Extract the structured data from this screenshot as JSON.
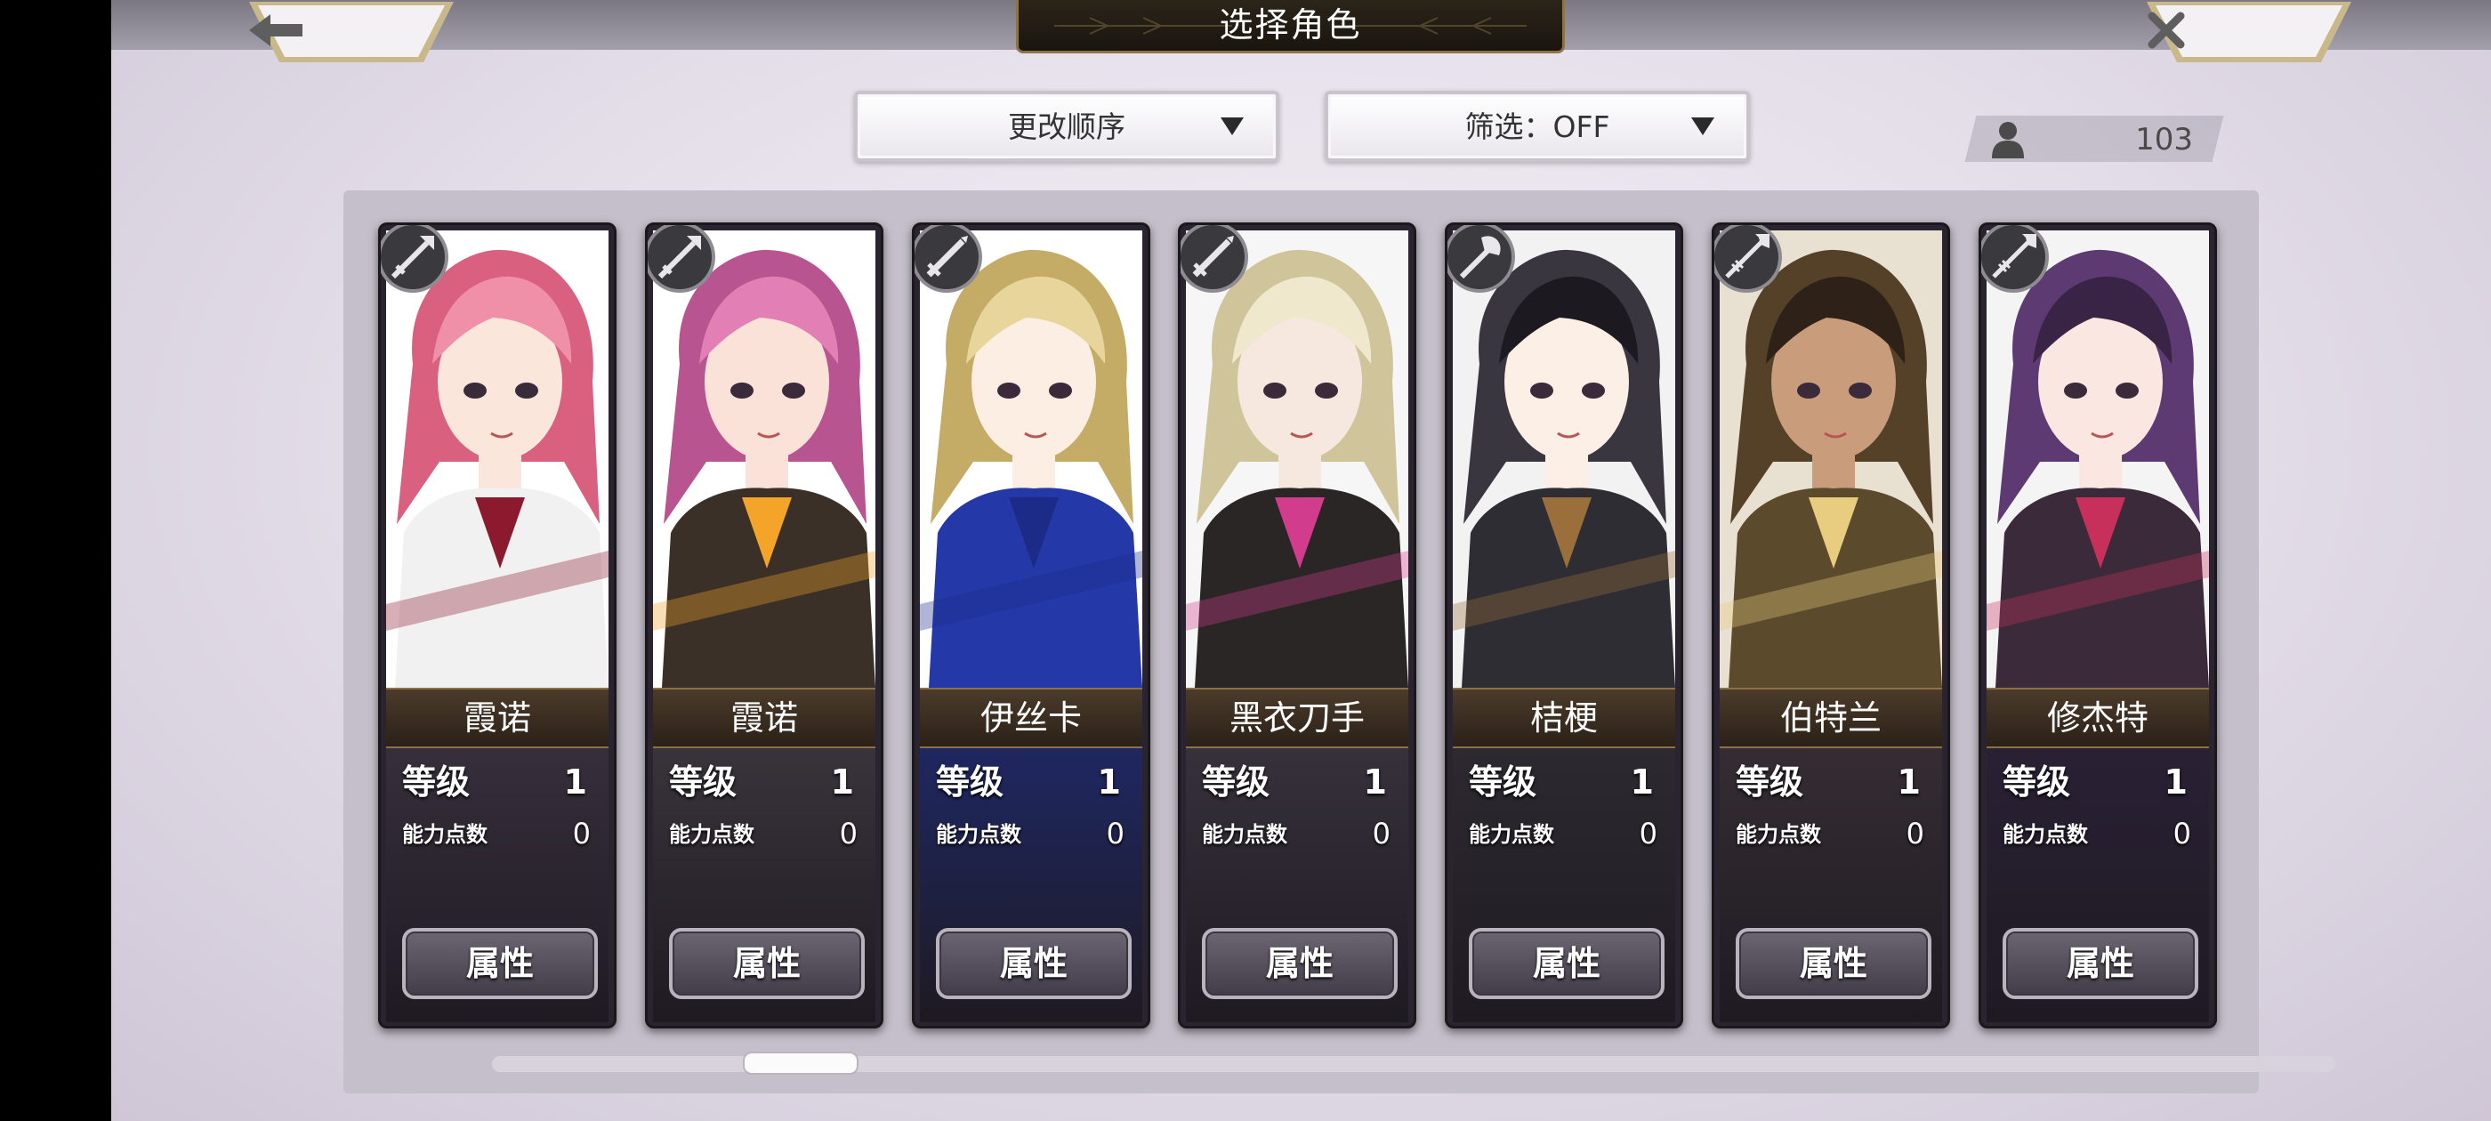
{
  "header": {
    "title": "选择角色",
    "back_icon": "left-arrow-icon",
    "close_icon": "close-x-icon"
  },
  "toolbar": {
    "sort_label": "更改顺序",
    "filter_label": "筛选：OFF",
    "character_count": "103"
  },
  "card_labels": {
    "level": "等级",
    "ability_points": "能力点数",
    "attributes_button": "属性"
  },
  "characters": [
    {
      "name": "霞诺",
      "level": "1",
      "ability_points": "0",
      "weapon": "lance-icon"
    },
    {
      "name": "霞诺",
      "level": "1",
      "ability_points": "0",
      "weapon": "lance-icon"
    },
    {
      "name": "伊丝卡",
      "level": "1",
      "ability_points": "0",
      "weapon": "sword-icon"
    },
    {
      "name": "黑衣刀手",
      "level": "1",
      "ability_points": "0",
      "weapon": "sword-icon"
    },
    {
      "name": "桔梗",
      "level": "1",
      "ability_points": "0",
      "weapon": "axe-icon"
    },
    {
      "name": "伯特兰",
      "level": "1",
      "ability_points": "0",
      "weapon": "spear-icon"
    },
    {
      "name": "修杰特",
      "level": "1",
      "ability_points": "0",
      "weapon": "spear-icon"
    }
  ],
  "colors": {
    "name_band": "#3a2d20",
    "gold_trim": "#8c7447",
    "background": "#e3dde8"
  }
}
